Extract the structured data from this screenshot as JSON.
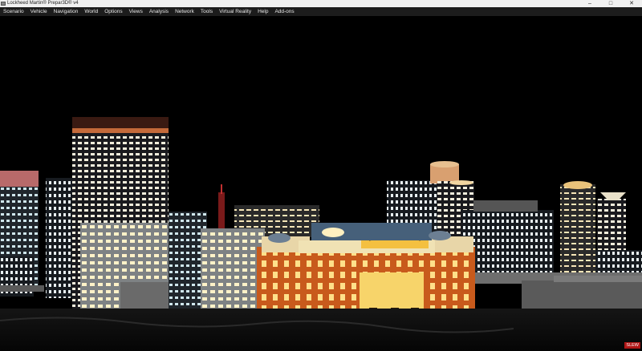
{
  "window": {
    "title": "Lockheed Martin® Prepar3D® v4",
    "minimize_glyph": "–",
    "maximize_glyph": "□",
    "close_glyph": "✕"
  },
  "menu": [
    "Scenario",
    "Vehicle",
    "Navigation",
    "World",
    "Options",
    "Views",
    "Analysis",
    "Network",
    "Tools",
    "Virtual Reality",
    "Help",
    "Add-ons"
  ],
  "status": {
    "mode_badge": "SLEW"
  },
  "colors": {
    "sky": "#000000",
    "building_lit": "#d97a2a",
    "window_light": "#fff4c8",
    "slew_badge": "#b01616"
  },
  "icons": [
    "app-icon",
    "minimize-icon",
    "maximize-icon",
    "close-icon"
  ]
}
